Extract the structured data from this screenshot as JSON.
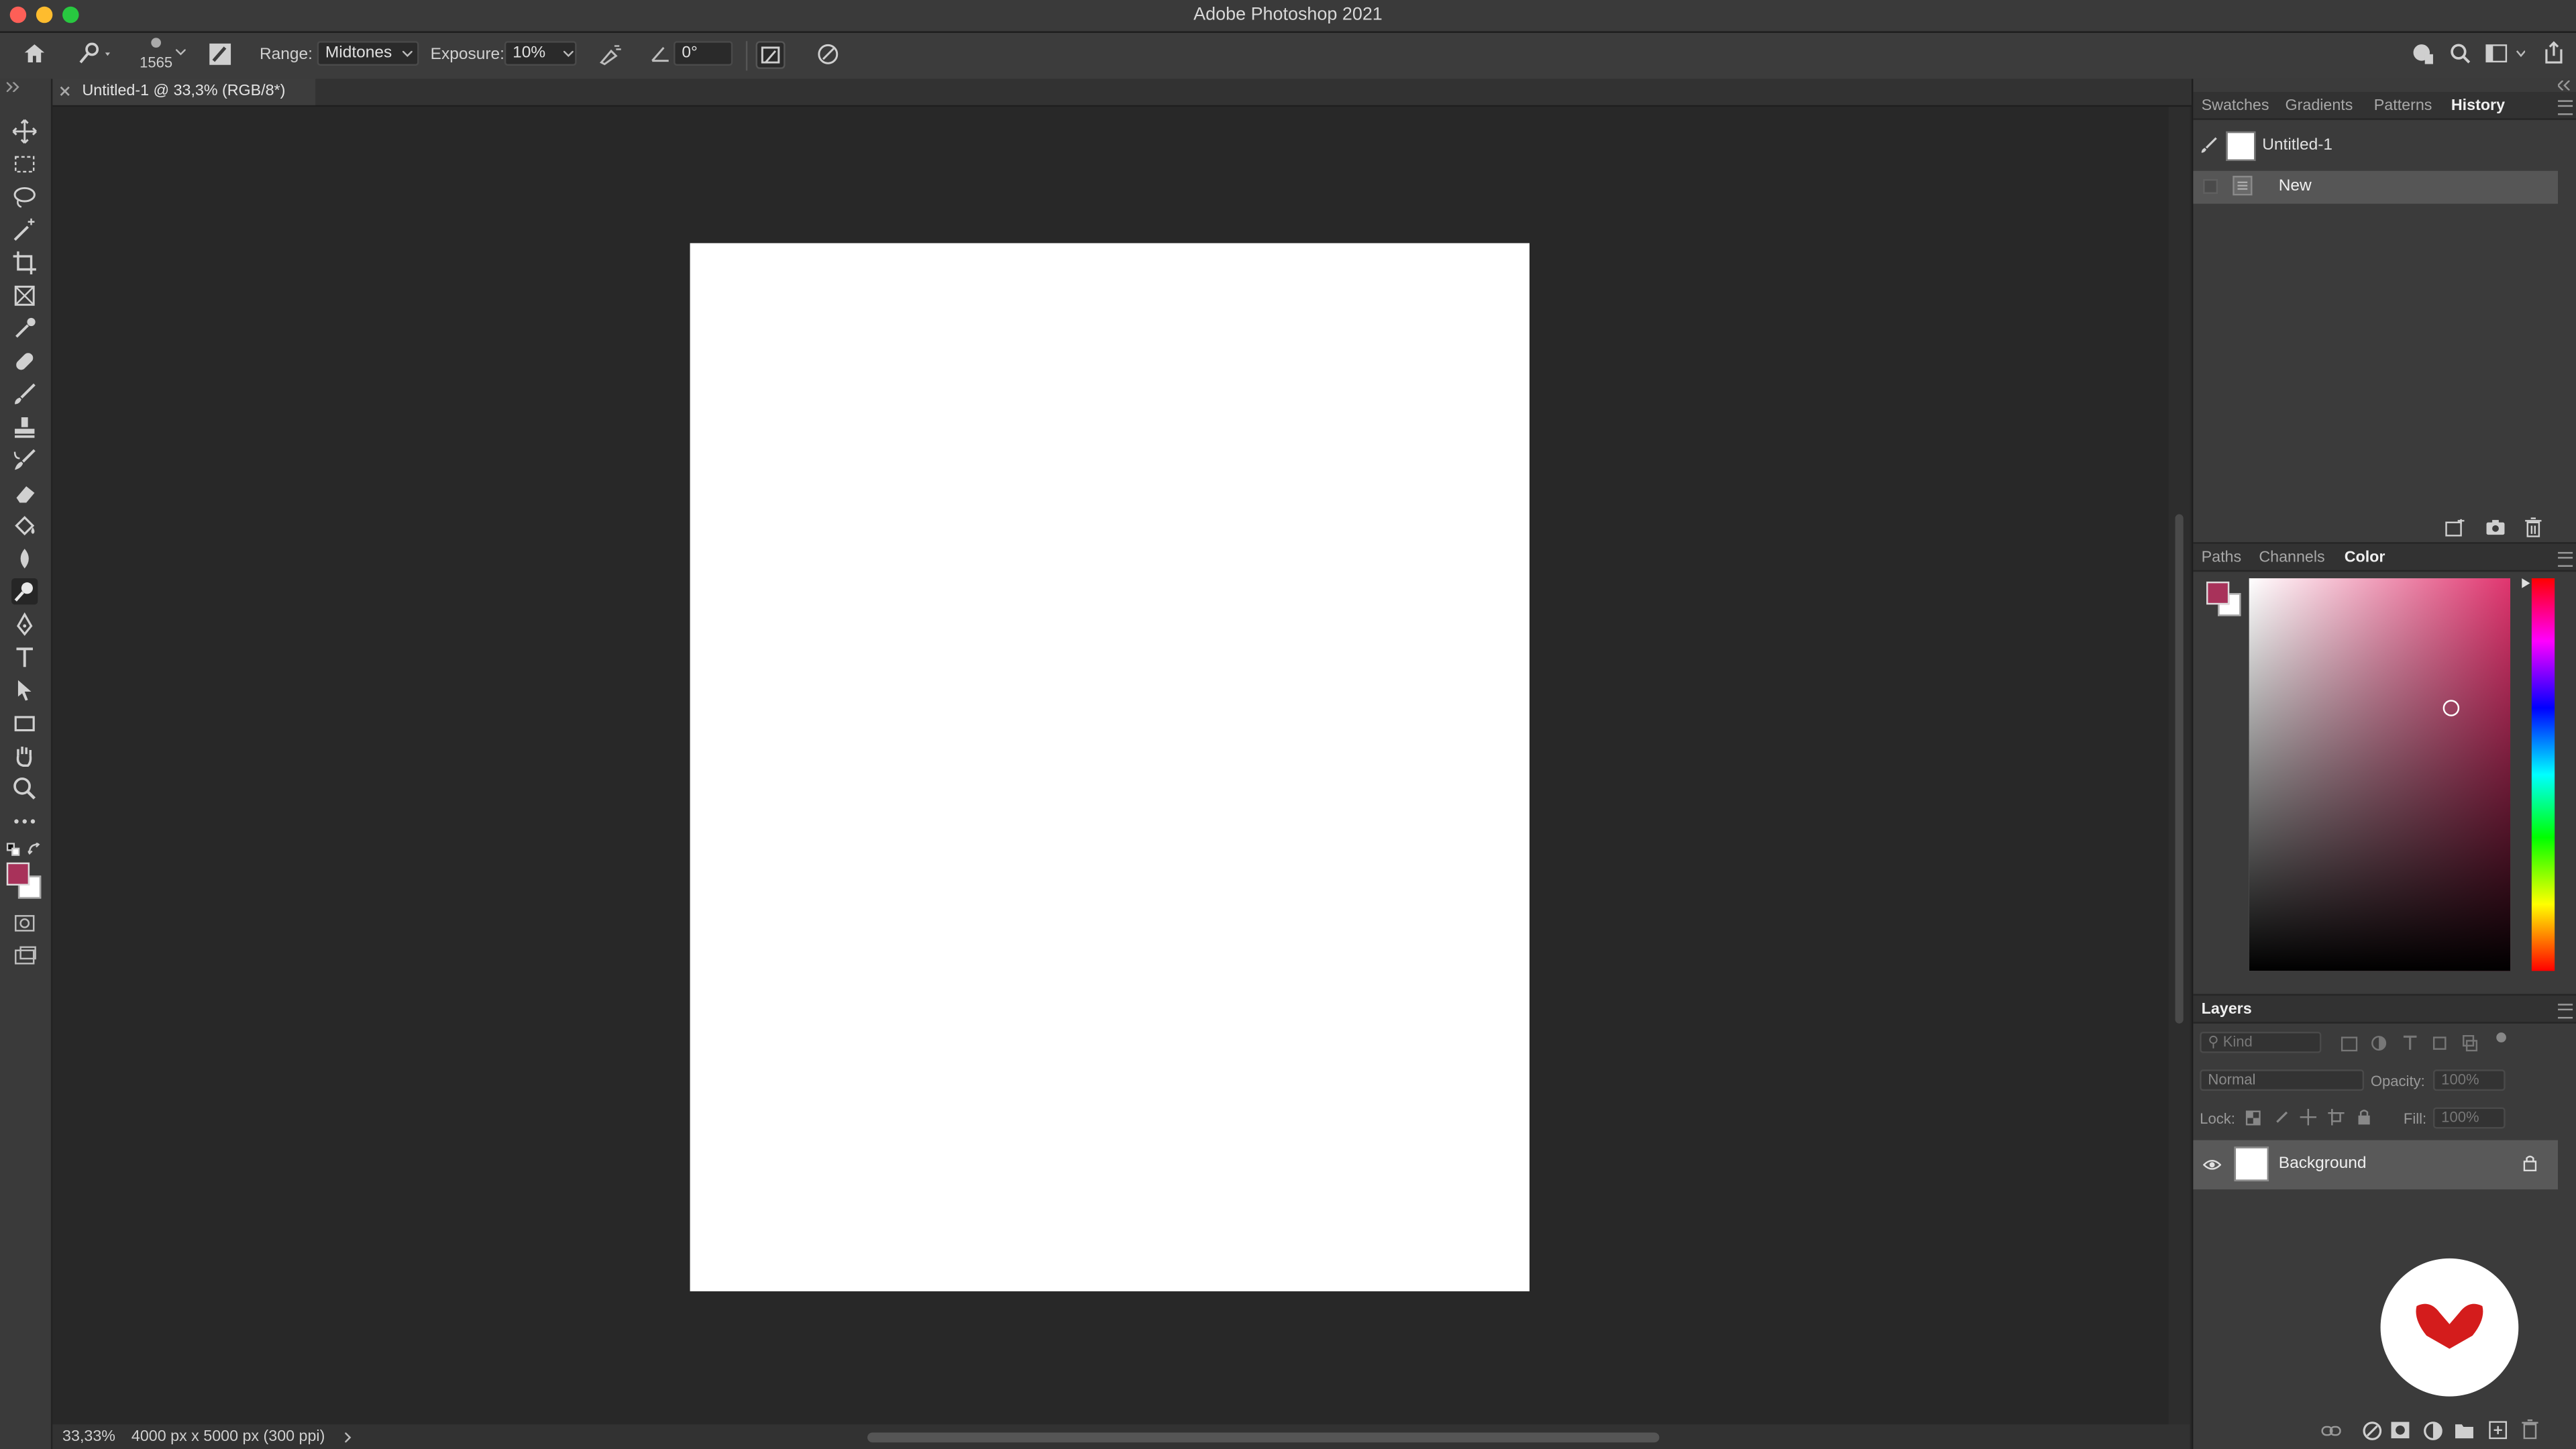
{
  "window": {
    "title": "Adobe Photoshop 2021",
    "traffic_lights": [
      "#fe5f57",
      "#febc2e",
      "#28c840"
    ]
  },
  "options_bar": {
    "brush_size": "1565",
    "range_label": "Range:",
    "range_value": "Midtones",
    "exposure_label": "Exposure:",
    "exposure_value": "10%",
    "angle_value": "0°"
  },
  "document_tab": {
    "title": "Untitled-1 @ 33,3% (RGB/8*)"
  },
  "status_bar": {
    "zoom": "33,33%",
    "doc_info": "4000 px x 5000 px (300 ppi)"
  },
  "colors": {
    "foreground": "#a8325a",
    "background": "#ffffff",
    "picker_hue": "#e0356f",
    "logo_red": "#d41c1c"
  },
  "history_panel": {
    "tabs": [
      "Swatches",
      "Gradients",
      "Patterns",
      "History"
    ],
    "active_tab": "History",
    "snapshot_label": "Untitled-1",
    "states": [
      "New"
    ]
  },
  "color_panel": {
    "tabs": [
      "Paths",
      "Channels",
      "Color"
    ],
    "active_tab": "Color"
  },
  "layers_panel": {
    "tab": "Layers",
    "filter_placeholder": "Kind",
    "blend_mode": "Normal",
    "opacity_label": "Opacity:",
    "opacity_value": "100%",
    "lock_label": "Lock:",
    "fill_label": "Fill:",
    "fill_value": "100%",
    "layers": [
      {
        "name": "Background",
        "visible": true,
        "locked": true
      }
    ]
  },
  "toolbar": {
    "tools": [
      "move-tool",
      "marquee-tool",
      "lasso-tool",
      "magic-wand-tool",
      "crop-tool",
      "frame-tool",
      "eyedropper-tool",
      "healing-brush-tool",
      "brush-tool",
      "clone-stamp-tool",
      "history-brush-tool",
      "eraser-tool",
      "paint-bucket-tool",
      "blur-tool",
      "dodge-tool",
      "pen-tool",
      "type-tool",
      "path-selection-tool",
      "rectangle-tool",
      "hand-tool",
      "zoom-tool",
      "more-tools"
    ],
    "active_tool": "dodge-tool"
  }
}
